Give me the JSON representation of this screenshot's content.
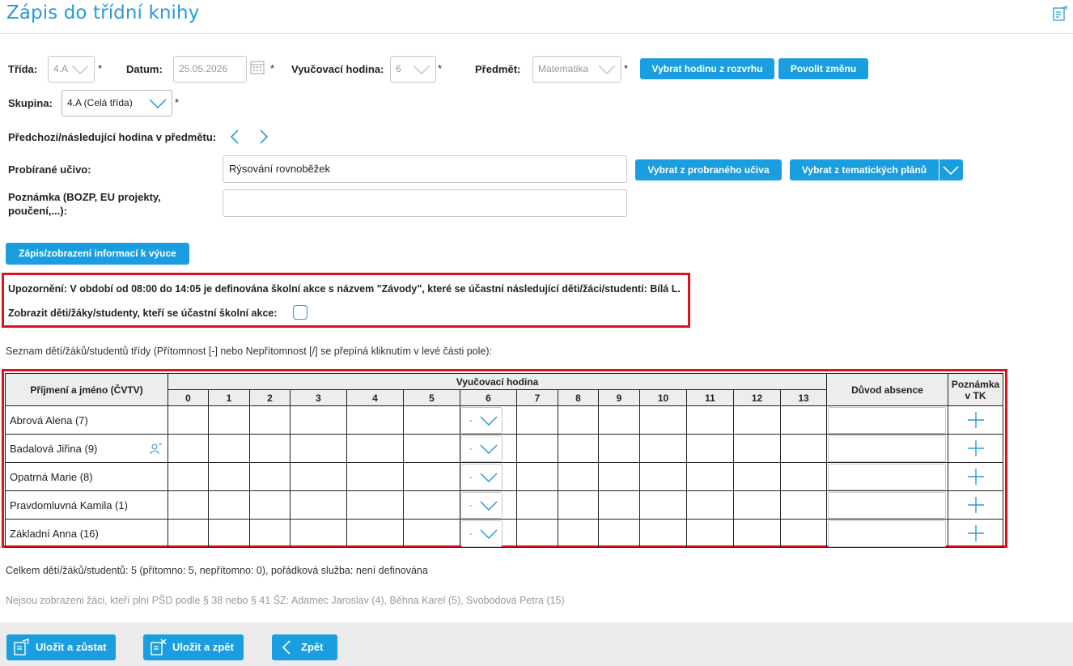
{
  "header": {
    "title": "Zápis do třídní knihy",
    "help_icon": "document-edit-icon"
  },
  "form": {
    "class_label": "Třída:",
    "class_value": "4.A",
    "date_label": "Datum:",
    "date_value": "25.05.2026",
    "lesson_label": "Vyučovací hodina:",
    "lesson_value": "6",
    "subject_label": "Předmět:",
    "subject_value": "Matematika",
    "required_mark": "*",
    "btn_pick_schedule": "Vybrat hodinu z rozvrhu",
    "btn_allow_change": "Povolit změnu",
    "group_label": "Skupina:",
    "group_value": "4.A (Celá třída)",
    "prevnext_label": "Předchozí/následující hodina v předmětu:",
    "topic_label": "Probírané učivo:",
    "topic_value": "Rýsování rovnoběžek",
    "btn_pick_topic": "Vybrat z probraného učiva",
    "btn_pick_plan": "Vybrat z tematických plánů",
    "remark_label_1": "Poznámka (BOZP, EU projekty,",
    "remark_label_2": "poučení,...):",
    "remark_value": "",
    "btn_lesson_info": "Zápis/zobrazení informací k výuce"
  },
  "warning": {
    "prefix": "Upozornění:",
    "text": " V období od 08:00 do 14:05 je definována školní akce s názvem \"Závody\", které se účastní následující děti/žáci/studenti: Bílá L.",
    "show_label": "Zobrazit děti/žáky/studenty, kteří se účastní školní akce:"
  },
  "list_caption": "Seznam dětí/žáků/studentů třídy (Přítomnost [-] nebo Nepřítomnost [/] se přepíná kliknutím v levé části pole):",
  "table": {
    "col_name": "Příjmení a jméno (ČVTV)",
    "col_lesson": "Vyučovací hodina",
    "lessons": [
      "0",
      "1",
      "2",
      "3",
      "4",
      "5",
      "6",
      "7",
      "8",
      "9",
      "10",
      "11",
      "12",
      "13"
    ],
    "col_reason": "Důvod absence",
    "col_note_1": "Poznámka",
    "col_note_2": "v TK",
    "attendance_value": "-",
    "rows": [
      {
        "name": "Abrová Alena (7)",
        "has_icon": false
      },
      {
        "name": "Badalová Jiřina (9)",
        "has_icon": true
      },
      {
        "name": "Opatrná Marie (8)",
        "has_icon": false
      },
      {
        "name": "Pravdomluvná Kamila (1)",
        "has_icon": false
      },
      {
        "name": "Základní Anna (16)",
        "has_icon": false
      }
    ]
  },
  "summary": "Celkem dětí/žáků/studentů: 5 (přítomno: 5, nepřítomno: 0), pořádková služba: není definována",
  "psd_note": "Nejsou zobrazeni žáci, kteří plní PŠD podle § 38 nebo § 41 ŠZ: Adamec Jaroslav (4), Běhna Karel (5), Svobodová Petra (15)",
  "footer": {
    "save_stay": "Uložit a zůstat",
    "save_back": "Uložit a zpět",
    "back": "Zpět"
  },
  "colors": {
    "accent": "#1a9ee0",
    "title": "#2a9ad8",
    "alert_border": "#e3101e"
  }
}
